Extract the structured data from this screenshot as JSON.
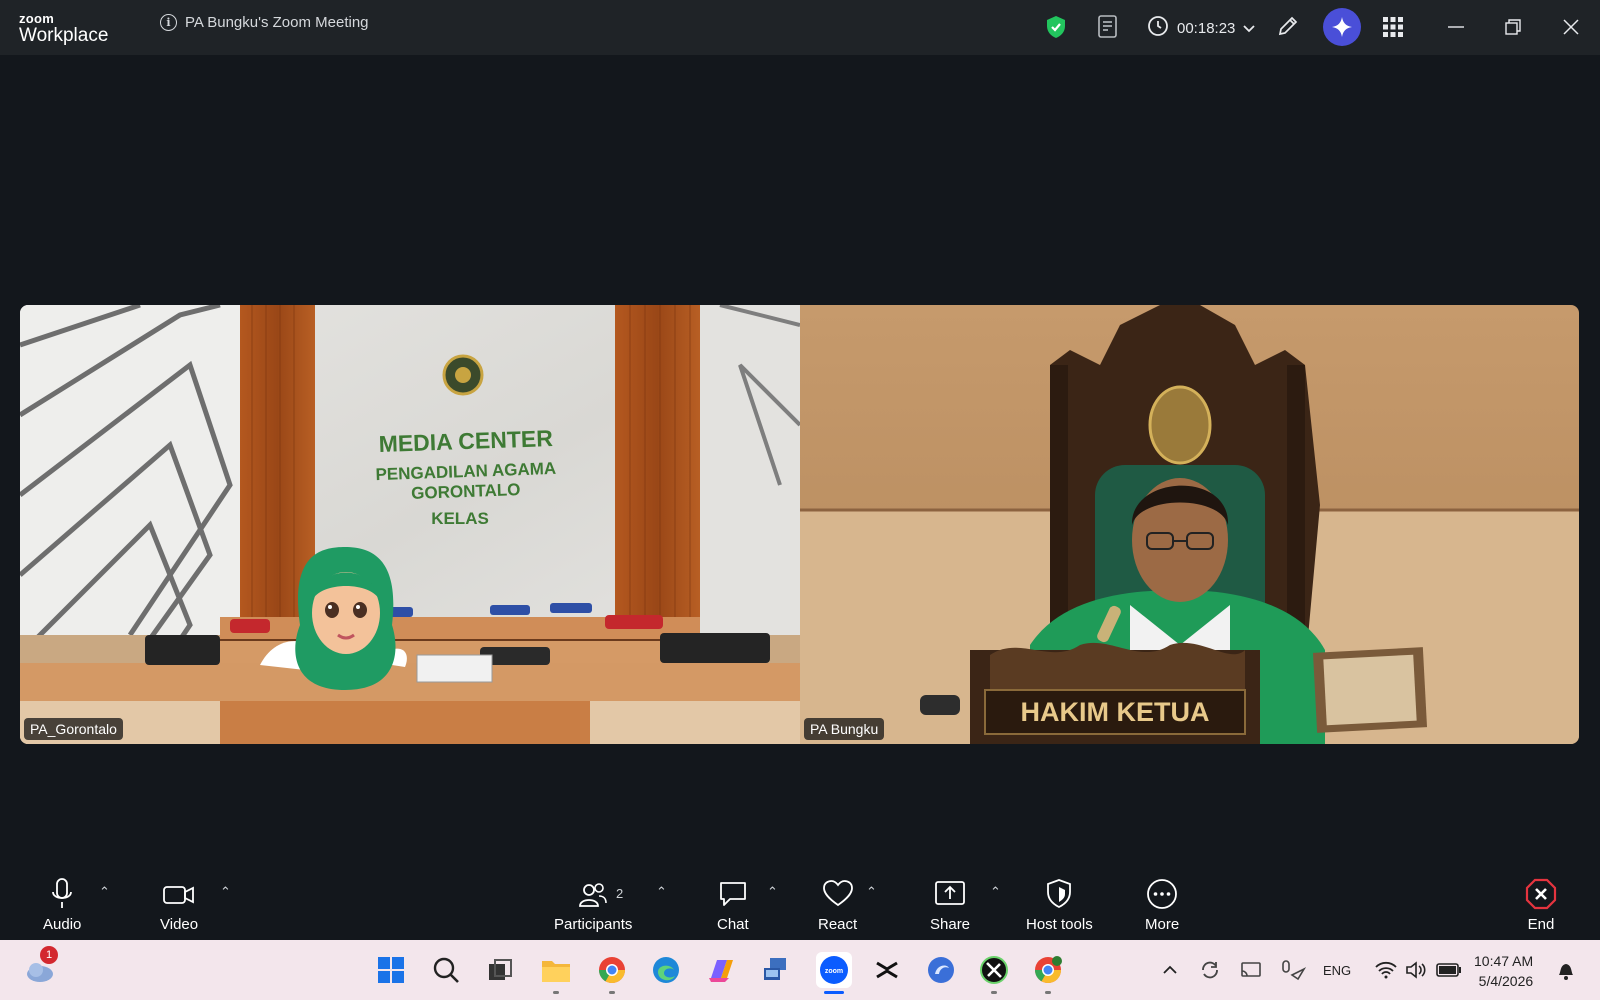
{
  "app": {
    "brand_top": "zoom",
    "brand_bottom": "Workplace"
  },
  "meeting": {
    "title": "PA Bungku's Zoom Meeting",
    "timer": "00:18:23"
  },
  "participants_tiles": [
    {
      "name": "PA_Gorontalo",
      "sign_line1": "MEDIA CENTER",
      "sign_line2": "PENGADILAN AGAMA",
      "sign_line3": "GORONTALO",
      "sign_line4": "KELAS"
    },
    {
      "name": "PA Bungku",
      "desk_plate": "HAKIM  KETUA"
    }
  ],
  "toolbar": {
    "audio": "Audio",
    "video": "Video",
    "participants": "Participants",
    "participants_count": "2",
    "chat": "Chat",
    "react": "React",
    "share": "Share",
    "host_tools": "Host tools",
    "more": "More",
    "end": "End"
  },
  "taskbar": {
    "weather_badge": "1",
    "language": "ENG",
    "time": "10:47 AM",
    "date": "5/4/2026"
  },
  "colors": {
    "accent_ai": "#4a4fd8",
    "shield_green": "#22c55e",
    "end_red": "#e5343f",
    "zoom_blue": "#0b5cff"
  }
}
